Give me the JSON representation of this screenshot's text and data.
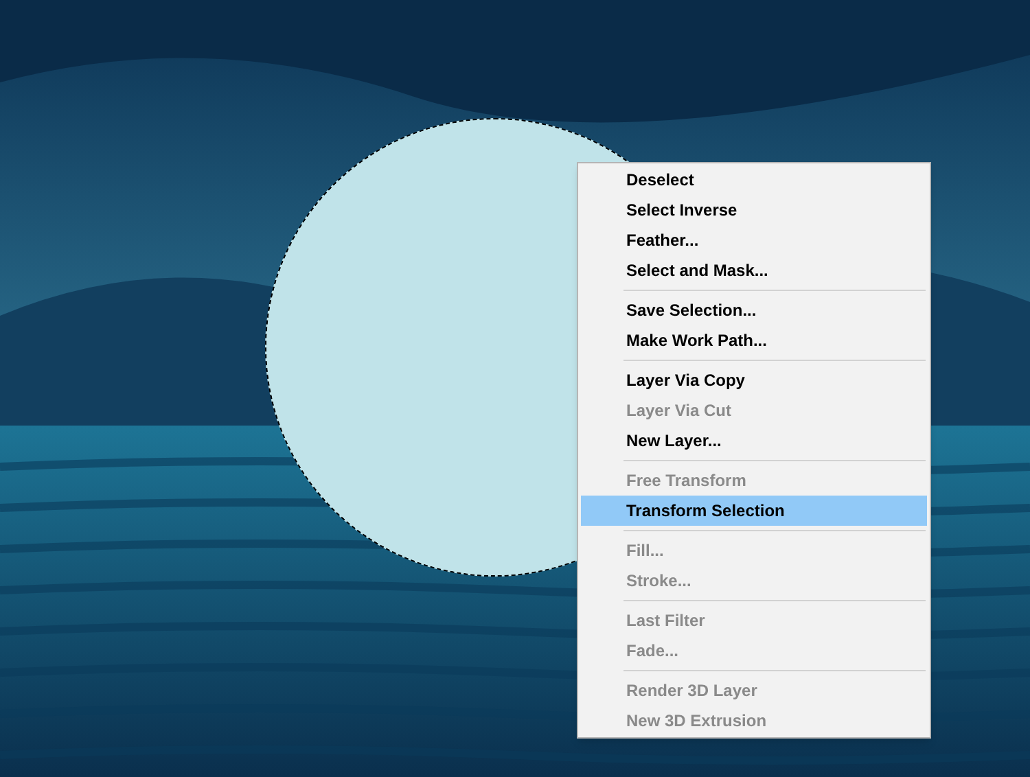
{
  "context_menu": {
    "groups": [
      {
        "items": [
          {
            "label": "Deselect",
            "disabled": false,
            "selected": false
          },
          {
            "label": "Select Inverse",
            "disabled": false,
            "selected": false
          },
          {
            "label": "Feather...",
            "disabled": false,
            "selected": false
          },
          {
            "label": "Select and Mask...",
            "disabled": false,
            "selected": false
          }
        ]
      },
      {
        "items": [
          {
            "label": "Save Selection...",
            "disabled": false,
            "selected": false
          },
          {
            "label": "Make Work Path...",
            "disabled": false,
            "selected": false
          }
        ]
      },
      {
        "items": [
          {
            "label": "Layer Via Copy",
            "disabled": false,
            "selected": false
          },
          {
            "label": "Layer Via Cut",
            "disabled": true,
            "selected": false
          },
          {
            "label": "New Layer...",
            "disabled": false,
            "selected": false
          }
        ]
      },
      {
        "items": [
          {
            "label": "Free Transform",
            "disabled": true,
            "selected": false
          },
          {
            "label": "Transform Selection",
            "disabled": false,
            "selected": true
          }
        ]
      },
      {
        "items": [
          {
            "label": "Fill...",
            "disabled": true,
            "selected": false
          },
          {
            "label": "Stroke...",
            "disabled": true,
            "selected": false
          }
        ]
      },
      {
        "items": [
          {
            "label": "Last Filter",
            "disabled": true,
            "selected": false
          },
          {
            "label": "Fade...",
            "disabled": true,
            "selected": false
          }
        ]
      },
      {
        "items": [
          {
            "label": "Render 3D Layer",
            "disabled": true,
            "selected": false
          },
          {
            "label": "New 3D Extrusion",
            "disabled": true,
            "selected": false
          }
        ]
      }
    ]
  }
}
